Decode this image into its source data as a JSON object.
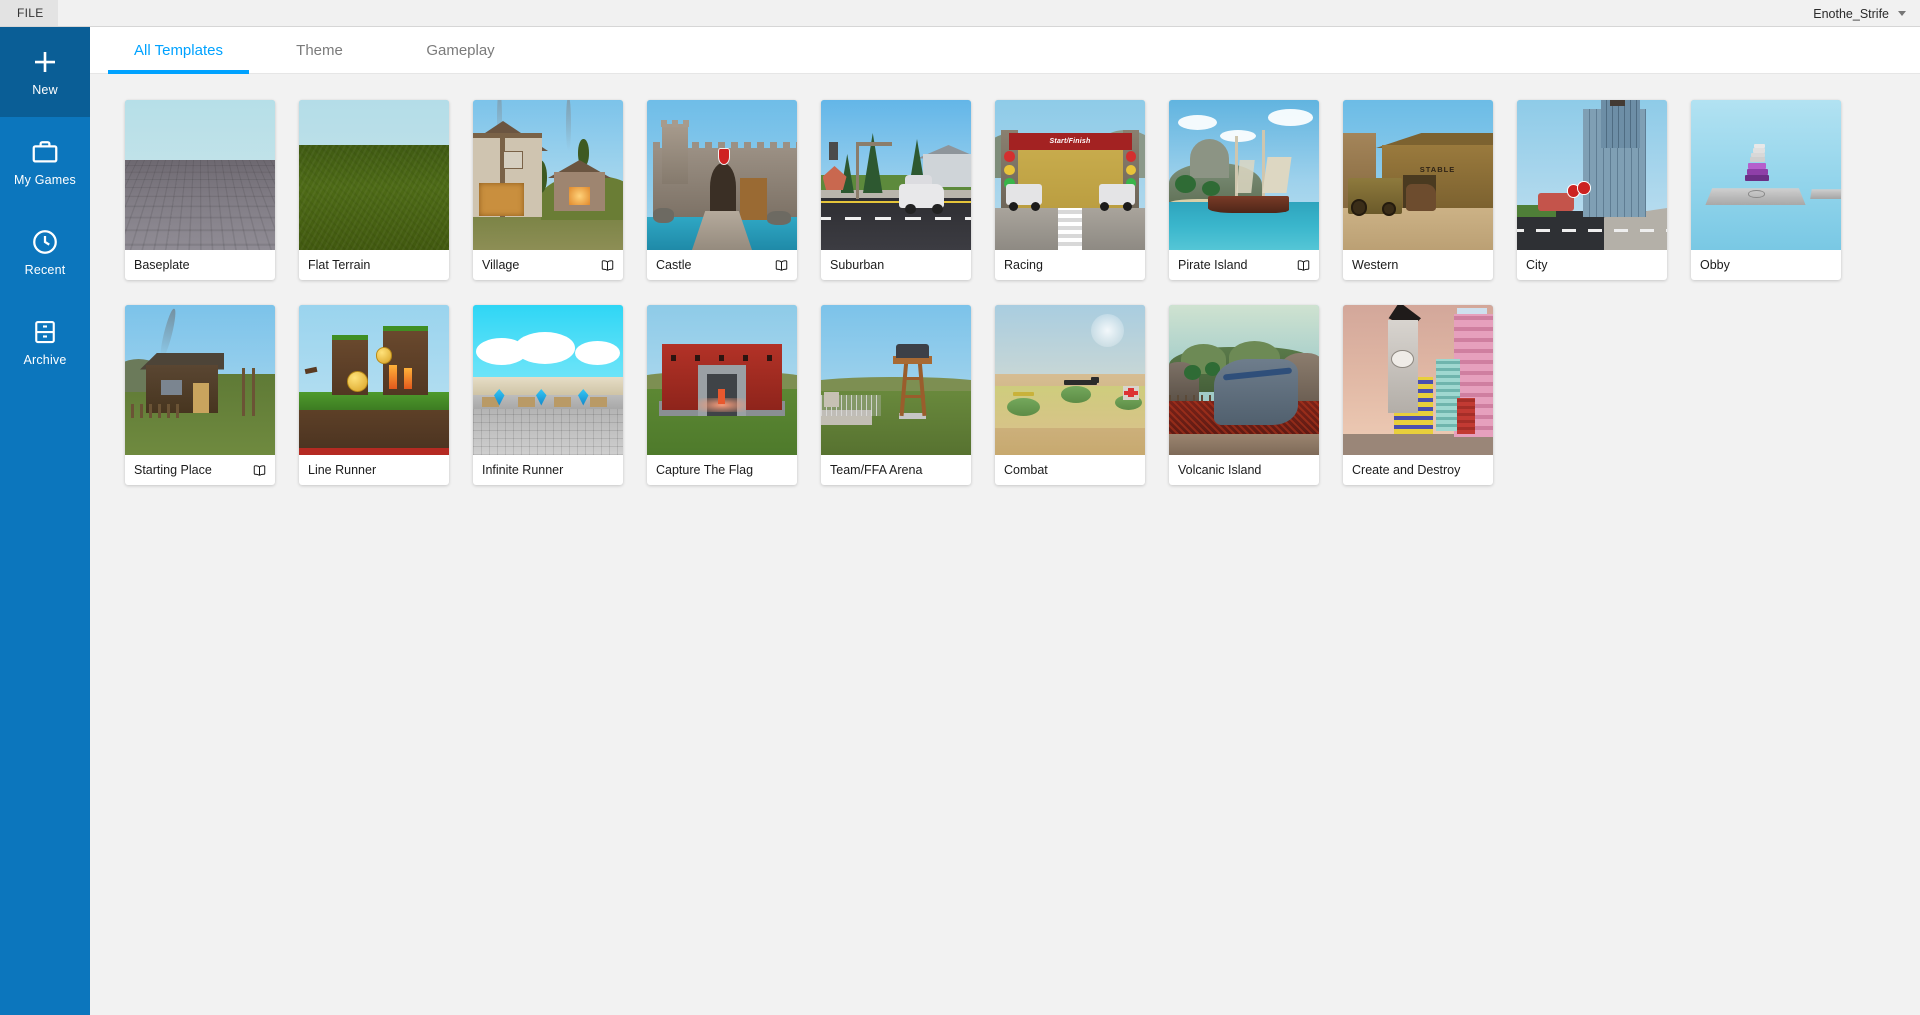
{
  "menubar": {
    "file_label": "FILE",
    "account_name": "Enothe_Strife",
    "caret_icon": "chevron-down-icon"
  },
  "sidebar": {
    "items": [
      {
        "label": "New",
        "icon": "plus-icon",
        "active": true
      },
      {
        "label": "My Games",
        "icon": "briefcase-icon",
        "active": false
      },
      {
        "label": "Recent",
        "icon": "clock-icon",
        "active": false
      },
      {
        "label": "Archive",
        "icon": "archive-icon",
        "active": false
      }
    ]
  },
  "tabs": [
    {
      "label": "All Templates",
      "active": true
    },
    {
      "label": "Theme",
      "active": false
    },
    {
      "label": "Gameplay",
      "active": false
    }
  ],
  "colors": {
    "accent": "#00a2ff",
    "sidebar": "#0c76bd",
    "sidebar_active": "#0a5e96",
    "page_bg": "#f2f2f2",
    "card_bg": "#ffffff"
  },
  "templates": [
    {
      "title": "Baseplate",
      "art": "t-baseplate",
      "has_tutorial": false
    },
    {
      "title": "Flat Terrain",
      "art": "t-flat",
      "has_tutorial": false
    },
    {
      "title": "Village",
      "art": "t-village",
      "has_tutorial": true
    },
    {
      "title": "Castle",
      "art": "t-castle",
      "has_tutorial": true
    },
    {
      "title": "Suburban",
      "art": "t-sub",
      "has_tutorial": false
    },
    {
      "title": "Racing",
      "art": "t-race",
      "has_tutorial": false,
      "banner_text": "Start/Finish"
    },
    {
      "title": "Pirate Island",
      "art": "t-pirate",
      "has_tutorial": true
    },
    {
      "title": "Western",
      "art": "t-west",
      "has_tutorial": false,
      "sign_text": "STABLE"
    },
    {
      "title": "City",
      "art": "t-city",
      "has_tutorial": false
    },
    {
      "title": "Obby",
      "art": "t-obby",
      "has_tutorial": false
    },
    {
      "title": "Starting Place",
      "art": "t-start",
      "has_tutorial": true
    },
    {
      "title": "Line Runner",
      "art": "t-line",
      "has_tutorial": false
    },
    {
      "title": "Infinite Runner",
      "art": "t-inf",
      "has_tutorial": false
    },
    {
      "title": "Capture The Flag",
      "art": "t-ctf",
      "has_tutorial": false
    },
    {
      "title": "Team/FFA Arena",
      "art": "t-ffa",
      "has_tutorial": false
    },
    {
      "title": "Combat",
      "art": "t-cmb",
      "has_tutorial": false
    },
    {
      "title": "Volcanic Island",
      "art": "t-vol",
      "has_tutorial": false
    },
    {
      "title": "Create and Destroy",
      "art": "t-cad",
      "has_tutorial": false
    }
  ],
  "tutorial_icon": "book-icon"
}
